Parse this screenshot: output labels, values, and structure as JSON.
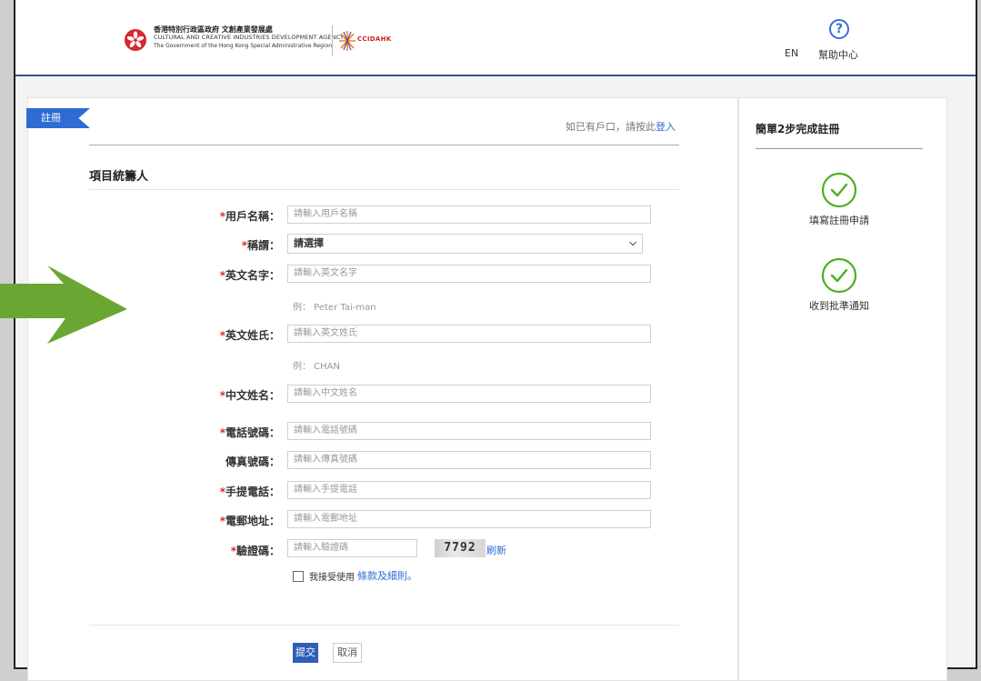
{
  "header": {
    "logo_line1": "香港特別行政區政府 文創產業發展處",
    "logo_line2": "CULTURAL AND CREATIVE INDUSTRIES DEVELOPMENT AGENCY",
    "logo_line3": "The Government of the Hong Kong Special Administrative Region",
    "partner_logo": "CCIDAHK",
    "help_icon": "?",
    "lang": "EN",
    "help": "幫助中心"
  },
  "form": {
    "tag": "註冊",
    "login_hint": "如已有戶口，請按此",
    "login_link": "登入",
    "section_title": "項目統籌人",
    "required_mark": "*",
    "fields": {
      "username": {
        "label": "用戶名稱：",
        "placeholder": "請輸入用戶名稱"
      },
      "title": {
        "label": "稱謂：",
        "value": "請選擇"
      },
      "first_name": {
        "label": "英文名字：",
        "placeholder": "請輸入英文名字",
        "example": "例：  Peter Tai-man"
      },
      "last_name": {
        "label": "英文姓氏：",
        "placeholder": "請輸入英文姓氏",
        "example": "例：  CHAN"
      },
      "chinese_name": {
        "label": "中文姓名：",
        "placeholder": "請輸入中文姓名"
      },
      "phone": {
        "label": "電話號碼：",
        "placeholder": "請輸入電話號碼"
      },
      "fax": {
        "label": "傳真號碼：",
        "placeholder": "請輸入傳真號碼"
      },
      "mobile": {
        "label": "手提電話：",
        "placeholder": "請輸入手提電話"
      },
      "email": {
        "label": "電郵地址：",
        "placeholder": "請輸入電郵地址"
      },
      "captcha": {
        "label": "驗證碼：",
        "placeholder": "請輸入驗證碼",
        "image_text": "7792",
        "refresh": "刷新"
      }
    },
    "agree_text": "我接受使用",
    "terms_link": "條款及細則。",
    "submit": "提交",
    "cancel": "取消"
  },
  "steps": {
    "title": "簡單2步完成註冊",
    "items": [
      {
        "label": "填寫註冊申請",
        "icon": "check-circle-icon"
      },
      {
        "label": "收到批準通知",
        "icon": "check-circle-icon"
      }
    ]
  },
  "colors": {
    "accent": "#2f6bd3",
    "required": "#e02828",
    "step_green": "#4caf22",
    "arrow_green": "#6aa632"
  }
}
